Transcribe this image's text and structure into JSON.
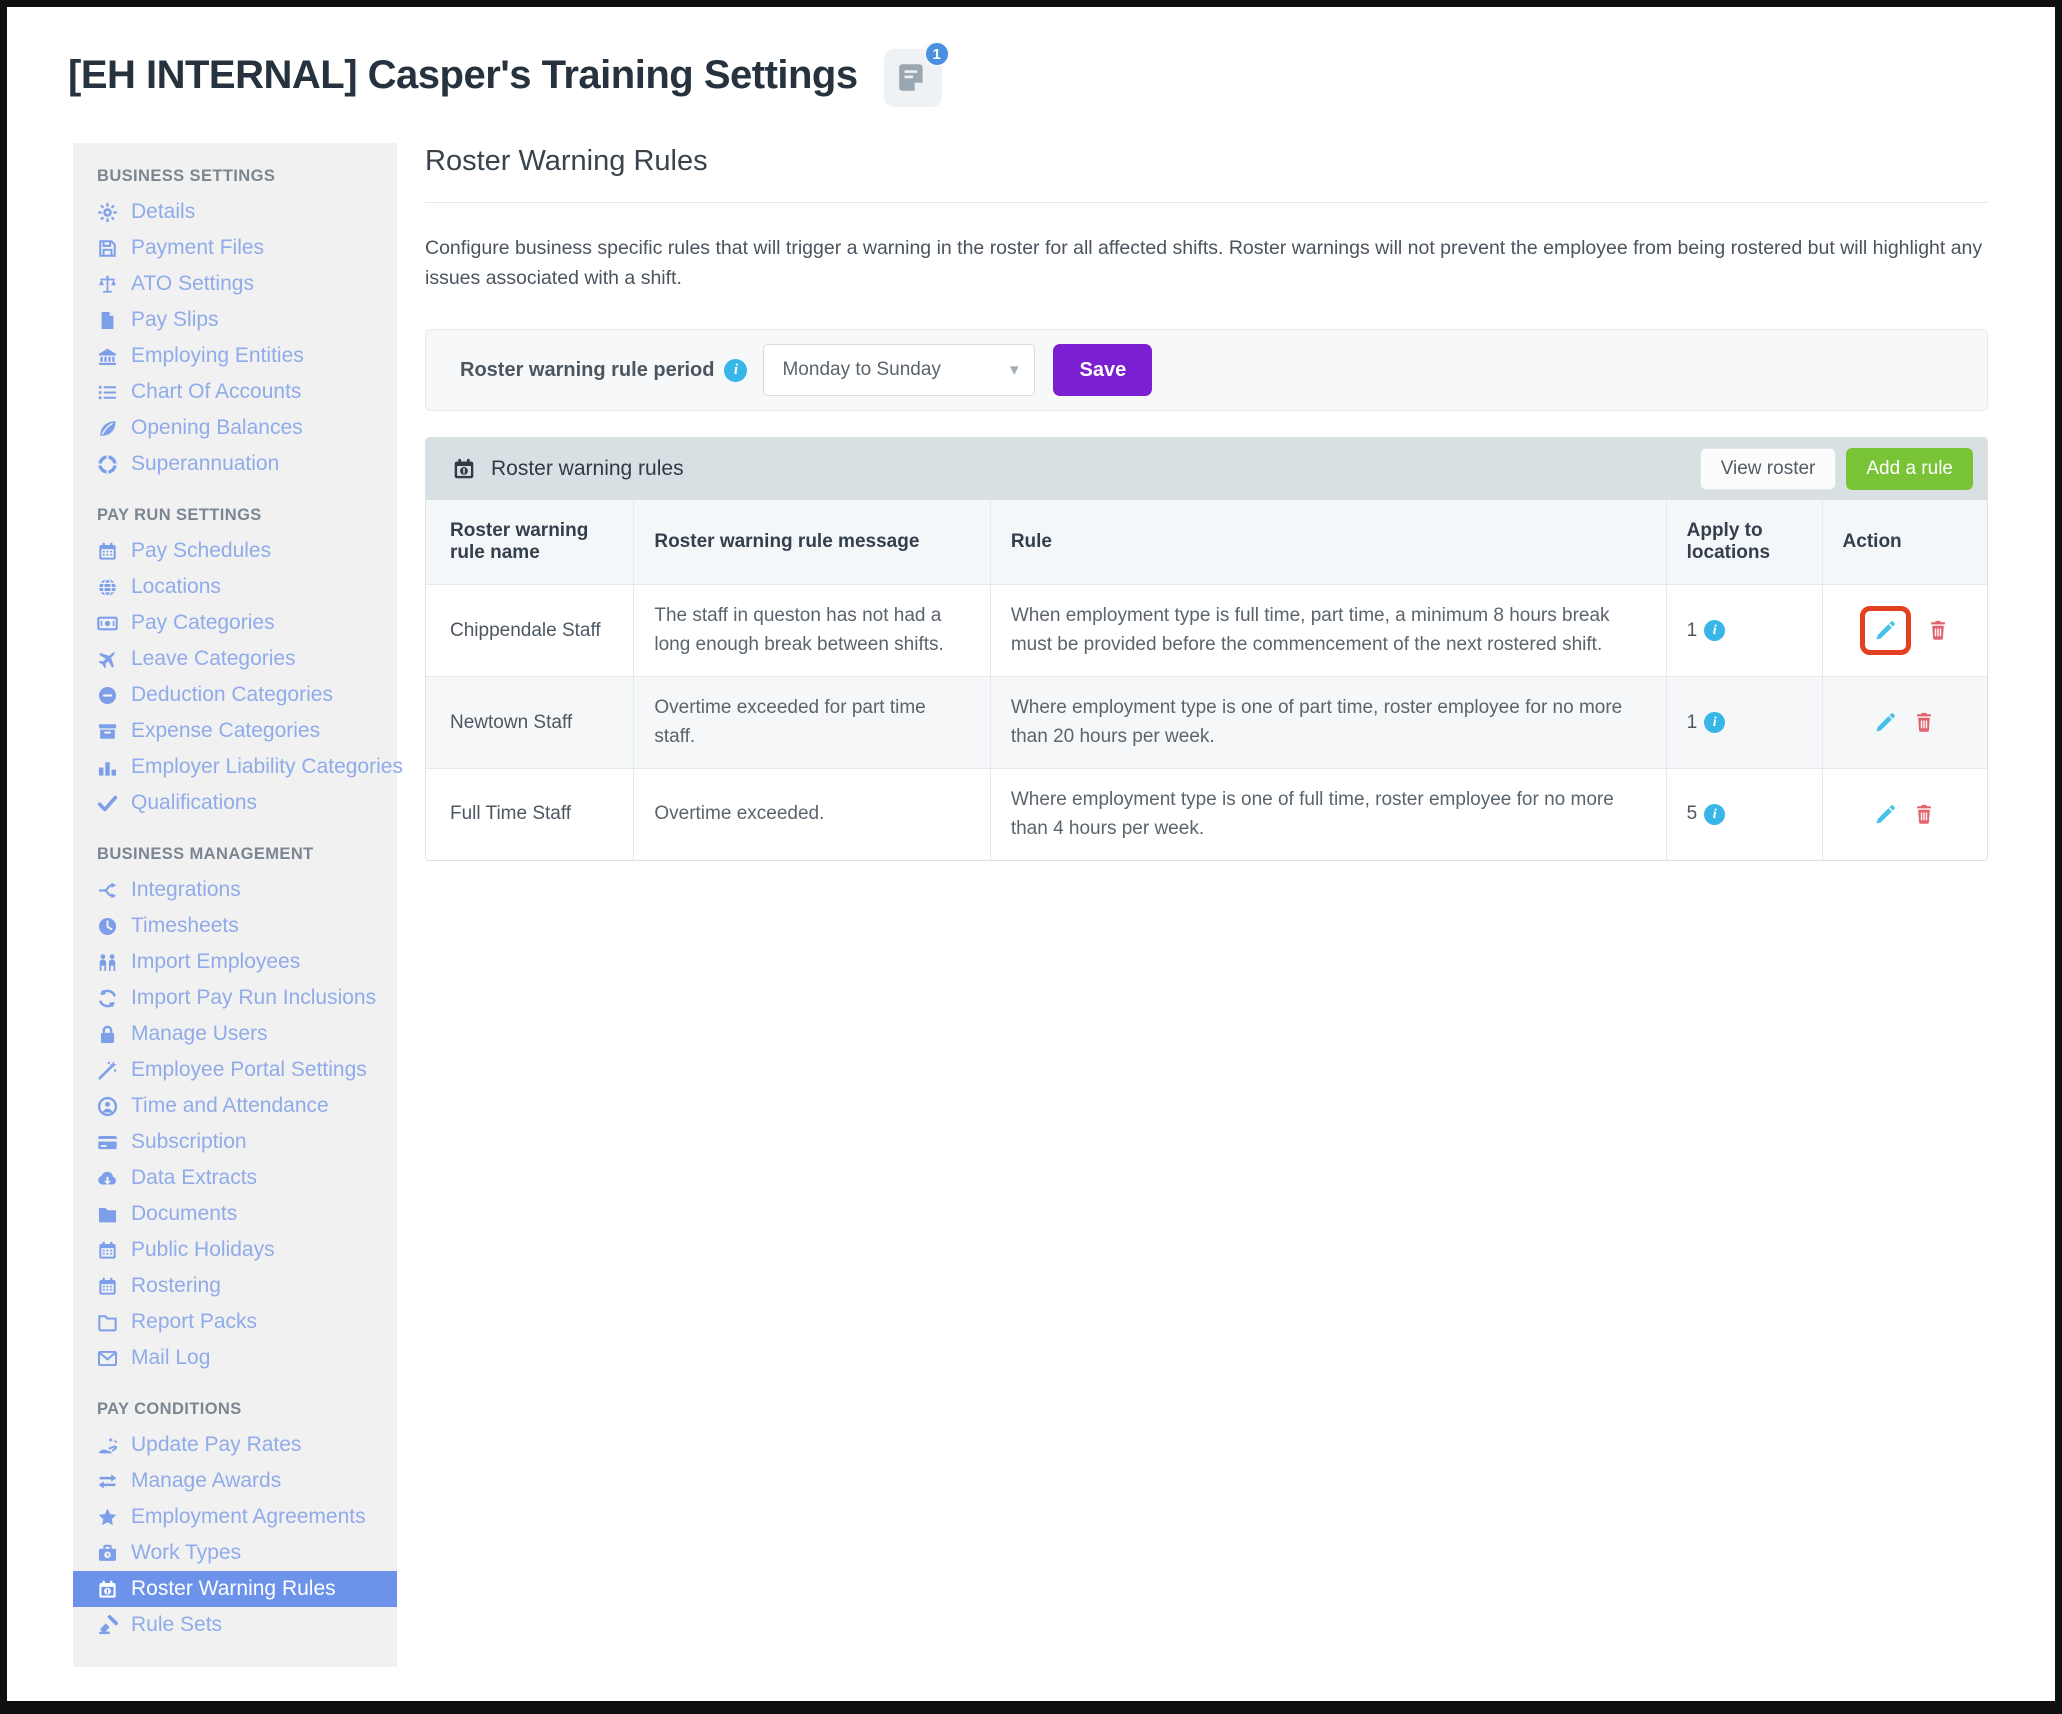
{
  "page": {
    "title": "[EH INTERNAL] Casper's Training Settings",
    "notes_badge": "1"
  },
  "colors": {
    "sidebar_active_bg": "#6c93e9",
    "sidebar_link": "#8fabe9",
    "save_button": "#7b1fd2",
    "add_rule_button": "#79c436",
    "card_header_bg": "#d9e0e3",
    "info_icon": "#38b6e8",
    "edit_icon": "#47c1ea",
    "delete_icon": "#e2636d",
    "highlight_box": "#e2401f"
  },
  "sidebar": {
    "sections": [
      {
        "label": "Business Settings",
        "items": [
          {
            "icon": "gear",
            "label": "Details"
          },
          {
            "icon": "floppy",
            "label": "Payment Files"
          },
          {
            "icon": "scale",
            "label": "ATO Settings"
          },
          {
            "icon": "file",
            "label": "Pay Slips"
          },
          {
            "icon": "bank",
            "label": "Employing Entities"
          },
          {
            "icon": "list",
            "label": "Chart Of Accounts"
          },
          {
            "icon": "leaf",
            "label": "Opening Balances"
          },
          {
            "icon": "lifering",
            "label": "Superannuation"
          }
        ]
      },
      {
        "label": "Pay Run Settings",
        "items": [
          {
            "icon": "calendar",
            "label": "Pay Schedules"
          },
          {
            "icon": "globe",
            "label": "Locations"
          },
          {
            "icon": "banknote",
            "label": "Pay Categories"
          },
          {
            "icon": "plane",
            "label": "Leave Categories"
          },
          {
            "icon": "minuscircle",
            "label": "Deduction Categories"
          },
          {
            "icon": "archive",
            "label": "Expense Categories"
          },
          {
            "icon": "barchart",
            "label": "Employer Liability Categories"
          },
          {
            "icon": "check",
            "label": "Qualifications"
          }
        ]
      },
      {
        "label": "Business Management",
        "items": [
          {
            "icon": "branch",
            "label": "Integrations"
          },
          {
            "icon": "clock",
            "label": "Timesheets"
          },
          {
            "icon": "people",
            "label": "Import Employees"
          },
          {
            "icon": "sync",
            "label": "Import Pay Run Inclusions"
          },
          {
            "icon": "lock",
            "label": "Manage Users"
          },
          {
            "icon": "wand",
            "label": "Employee Portal Settings"
          },
          {
            "icon": "userclock",
            "label": "Time and Attendance"
          },
          {
            "icon": "card",
            "label": "Subscription"
          },
          {
            "icon": "clouddl",
            "label": "Data Extracts"
          },
          {
            "icon": "folder",
            "label": "Documents"
          },
          {
            "icon": "calendar",
            "label": "Public Holidays"
          },
          {
            "icon": "calendar",
            "label": "Rostering"
          },
          {
            "icon": "folderoutline",
            "label": "Report Packs"
          },
          {
            "icon": "envelope",
            "label": "Mail Log"
          }
        ]
      },
      {
        "label": "Pay Conditions",
        "items": [
          {
            "icon": "handcoin",
            "label": "Update Pay Rates"
          },
          {
            "icon": "arrows",
            "label": "Manage Awards"
          },
          {
            "icon": "star",
            "label": "Employment Agreements"
          },
          {
            "icon": "briefcase",
            "label": "Work Types"
          },
          {
            "icon": "calendarwarn",
            "label": "Roster Warning Rules",
            "active": true
          },
          {
            "icon": "gavel",
            "label": "Rule Sets"
          }
        ]
      }
    ]
  },
  "main": {
    "heading": "Roster Warning Rules",
    "description": "Configure business specific rules that will trigger a warning in the roster for all affected shifts. Roster warnings will not prevent the employee from being rostered but will highlight any issues associated with a shift.",
    "period": {
      "label": "Roster warning rule period",
      "value": "Monday to Sunday",
      "save_label": "Save"
    },
    "table": {
      "title": "Roster warning rules",
      "view_roster_label": "View roster",
      "add_rule_label": "Add a rule",
      "columns": [
        "Roster warning rule name",
        "Roster warning rule message",
        "Rule",
        "Apply to locations",
        "Action"
      ],
      "rows": [
        {
          "name": "Chippendale Staff",
          "message": "The staff in queston has not had a long enough break between shifts.",
          "rule": "When employment type is full time, part time, a minimum 8 hours break must be provided before the commencement of the next rostered shift.",
          "locations": "1",
          "edit_highlighted": true
        },
        {
          "name": "Newtown Staff",
          "message": "Overtime exceeded for part time staff.",
          "rule": "Where employment type is one of part time, roster employee for no more than 20 hours per week.",
          "locations": "1",
          "edit_highlighted": false
        },
        {
          "name": "Full Time Staff",
          "message": "Overtime exceeded.",
          "rule": "Where employment type is one of full time, roster employee for no more than 4 hours per week.",
          "locations": "5",
          "edit_highlighted": false
        }
      ]
    }
  }
}
